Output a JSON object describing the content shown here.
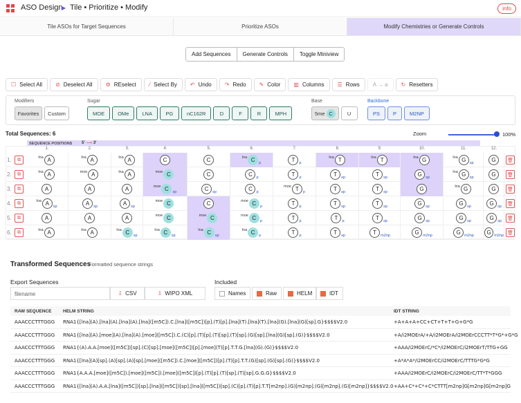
{
  "header": {
    "app_title": "ASO Design",
    "breadcrumb": "Tile • Prioritize • Modify",
    "info_label": "info",
    "accent": "#6a55d9"
  },
  "tabs": [
    {
      "label": "Tile ASOs for Target Sequences"
    },
    {
      "label": "Prioritize ASOs"
    },
    {
      "label": "Modify Chemistries or Generate Controls",
      "active": true
    }
  ],
  "segments": [
    "Add Sequences",
    "Generate Controls",
    "Toggle Miniview"
  ],
  "toolbar": [
    {
      "label": "Select All",
      "icon": "select-all-icon"
    },
    {
      "label": "Deselect All",
      "icon": "deselect-icon"
    },
    {
      "label": "REselect",
      "icon": "reselect-icon"
    },
    {
      "label": "Select By",
      "icon": "select-by-icon"
    },
    {
      "label": "Undo",
      "icon": "undo-icon"
    },
    {
      "label": "Redo",
      "icon": "redo-icon"
    },
    {
      "label": "Color",
      "icon": "color-icon"
    },
    {
      "label": "Columns",
      "icon": "columns-icon"
    },
    {
      "label": "Rows",
      "icon": "rows-icon"
    },
    {
      "label": "A → a",
      "icon": "case-icon"
    },
    {
      "label": "Resetters",
      "icon": "reset-icon"
    }
  ],
  "modifiers": {
    "label": "Modifiers",
    "items": [
      "Favorites",
      "Custom"
    ]
  },
  "sugar": {
    "label": "Sugar",
    "items": [
      "MOE",
      "OMe",
      "LNA",
      "PG",
      "nC162R",
      "D",
      "F",
      "R",
      "MPH"
    ]
  },
  "base": {
    "label": "Base",
    "items": [
      "5me",
      "U"
    ],
    "circle": "C"
  },
  "backbone": {
    "label": "Backbone",
    "items": [
      "PS",
      "P",
      "M2NP"
    ]
  },
  "totals": {
    "label": "Total Sequences: 6"
  },
  "zoom": {
    "label": "Zoom",
    "value": "100%"
  },
  "positions": {
    "label": "SEQUENCE POSITIONS",
    "five": "5'",
    "three": "3'",
    "arrow": "⟶",
    "cols": [
      "1.",
      "2.",
      "3.",
      "4.",
      "5.",
      "6.",
      "7.",
      "8.",
      "9.",
      "10.",
      "11.",
      "12."
    ]
  },
  "rows": [
    [
      [
        "lna",
        "A",
        ""
      ],
      [
        "lna",
        "A",
        ""
      ],
      [
        "lna",
        "A",
        ""
      ],
      [
        "",
        "C",
        ""
      ],
      [
        "",
        "C",
        ""
      ],
      [
        "lna",
        "C",
        "p"
      ],
      [
        "",
        "T",
        "p"
      ],
      [
        "lna",
        "T",
        ""
      ],
      [
        "lna",
        "T",
        ""
      ],
      [
        "lna",
        "G",
        ""
      ],
      [
        "lna",
        "G",
        "sp"
      ],
      [
        "",
        "G",
        ""
      ]
    ],
    [
      [
        "lna",
        "A",
        ""
      ],
      [
        "moe",
        "A",
        ""
      ],
      [
        "lna",
        "A",
        ""
      ],
      [
        "moe",
        "C",
        ""
      ],
      [
        "",
        "C",
        ""
      ],
      [
        "",
        "C",
        "p"
      ],
      [
        "",
        "T",
        "p"
      ],
      [
        "",
        "T",
        "sp"
      ],
      [
        "",
        "T",
        "sp"
      ],
      [
        "",
        "G",
        "sp"
      ],
      [
        "lna",
        "G",
        "sp"
      ],
      [
        "",
        "G",
        ""
      ]
    ],
    [
      [
        "",
        "A",
        ""
      ],
      [
        "",
        "A",
        ""
      ],
      [
        "",
        "A",
        ""
      ],
      [
        "moe",
        "C",
        "sp"
      ],
      [
        "",
        "C",
        "sp"
      ],
      [
        "",
        "C",
        "p"
      ],
      [
        "moe",
        "T",
        "p"
      ],
      [
        "",
        "T",
        "sp"
      ],
      [
        "",
        "T",
        "sp"
      ],
      [
        "",
        "G",
        ""
      ],
      [
        "lna",
        "G",
        ""
      ],
      [
        "",
        "G",
        ""
      ]
    ],
    [
      [
        "lna",
        "A",
        "sp"
      ],
      [
        "",
        "A",
        "sp"
      ],
      [
        "",
        "A",
        "sp"
      ],
      [
        "moe",
        "C",
        ""
      ],
      [
        "",
        "C",
        ""
      ],
      [
        "moe",
        "C",
        "p"
      ],
      [
        "",
        "T",
        "p"
      ],
      [
        "",
        "T",
        "sp"
      ],
      [
        "",
        "T",
        "sp"
      ],
      [
        "",
        "G",
        "sp"
      ],
      [
        "",
        "G",
        "sp"
      ],
      [
        "",
        "G",
        "sp"
      ]
    ],
    [
      [
        "",
        "A",
        ""
      ],
      [
        "",
        "A",
        ""
      ],
      [
        "",
        "A",
        ""
      ],
      [
        "moe",
        "C",
        ""
      ],
      [
        "moe",
        "C",
        ""
      ],
      [
        "moe",
        "C",
        "p"
      ],
      [
        "",
        "T",
        "p"
      ],
      [
        "",
        "T",
        "p"
      ],
      [
        "",
        "T",
        "sp"
      ],
      [
        "",
        "G",
        "sp"
      ],
      [
        "",
        "G",
        "sp"
      ],
      [
        "",
        "G",
        "sp"
      ]
    ],
    [
      [
        "lna",
        "A",
        ""
      ],
      [
        "lna",
        "A",
        ""
      ],
      [
        "lna",
        "C",
        "sp"
      ],
      [
        "lna",
        "C",
        "sp"
      ],
      [
        "lna",
        "C",
        "sp"
      ],
      [
        "lna",
        "C",
        "p"
      ],
      [
        "",
        "T",
        "p"
      ],
      [
        "",
        "T",
        "sp"
      ],
      [
        "",
        "T",
        "m2np"
      ],
      [
        "",
        "G",
        "m2np"
      ],
      [
        "",
        "G",
        "m2np"
      ],
      [
        "",
        "G",
        "m2np"
      ]
    ]
  ],
  "transformed": {
    "title": "Transformed Sequences",
    "subtitle": "Formatted sequence strings"
  },
  "export": {
    "label": "Export Sequences",
    "placeholder": "filename",
    "csv": "CSV",
    "wipo": "WIPO XML"
  },
  "included": {
    "label": "Included",
    "items": [
      {
        "label": "Names",
        "on": false
      },
      {
        "label": "Raw",
        "on": true
      },
      {
        "label": "HELM",
        "on": true
      },
      {
        "label": "IDT",
        "on": true
      }
    ]
  },
  "table": {
    "headers": [
      "RAW SEQUENCE",
      "HELM STRING",
      "IDT STRING"
    ],
    "rows": [
      [
        "AAACCCTTTGGG",
        "RNA1{[lna](A).[lna](A).[lna](A).[lna]([m5C]).C.[lna]([m5C])[p].(T)[p].[lna](T).[lna](T).[lna](G).[lna](G)[sp].G}$$$$V2.0",
        "+A+A+A+CC+CT+T+T+G+G*G"
      ],
      [
        "AAACCCTTTGGG",
        "RNA1{[lna](A).[moe](A).[lna](A).[moe]([m5C]).C.(C)[p].(T)[p].(T)[sp].(T)[sp].(G)[sp].[lna](G)[sp].(G)}$$$$V2.0",
        "+A/i2MOErA/+A/i2MOErA/i2MOErCCCTT*T*G*+G*G"
      ],
      [
        "AAACCCTTTGGG",
        "RNA1{(A).A.A.[moe]([m5C])[sp].(C)[sp].[moe]([m5C])[p].[moe](T)[p].T.T.G.[lna](G).(G)}$$$$V2.0",
        "+AAA/i2MOErC/*C*/i2MOErC/i2MOErT/TTG+GG"
      ],
      [
        "AAACCCTTTGGG",
        "RNA1{[lna](A)[sp].(A)[sp].(A)[sp].[moe]([m5C]).C.[moe]([m5C])[p].(T)[p].T.T.(G)[sp].(G)[sp].(G)}$$$$V2.0",
        "+A*A*A*/i2MOErCC/i2MOErC/TTTG*G*G"
      ],
      [
        "AAACCCTTTGGG",
        "RNA1{A.A.A.[moe]([m5C]).[moe]([m5C]).[moe]([m5C])[p].(T)[p].(T)[sp].(T)[sp].G.G.G}$$$$V2.0",
        "+AAA/i2MOErC/i2MOErC/i2MOErC/TT*T*GGG"
      ],
      [
        "AAACCCTTTGGG",
        "RNA1{[lna](A).A.A.[lna]([m5C])[sp].[lna]([m5C])[sp].[lna]([m5C])[sp].(C)[p].(T)[p].T.T[m2np].(G)[m2np].(G)[m2np].(G)[m2np]}$$$$V2.0",
        "+AA+C*+C*+C*CTTT[m2np]G[m2np]G[m2np]G"
      ]
    ]
  }
}
